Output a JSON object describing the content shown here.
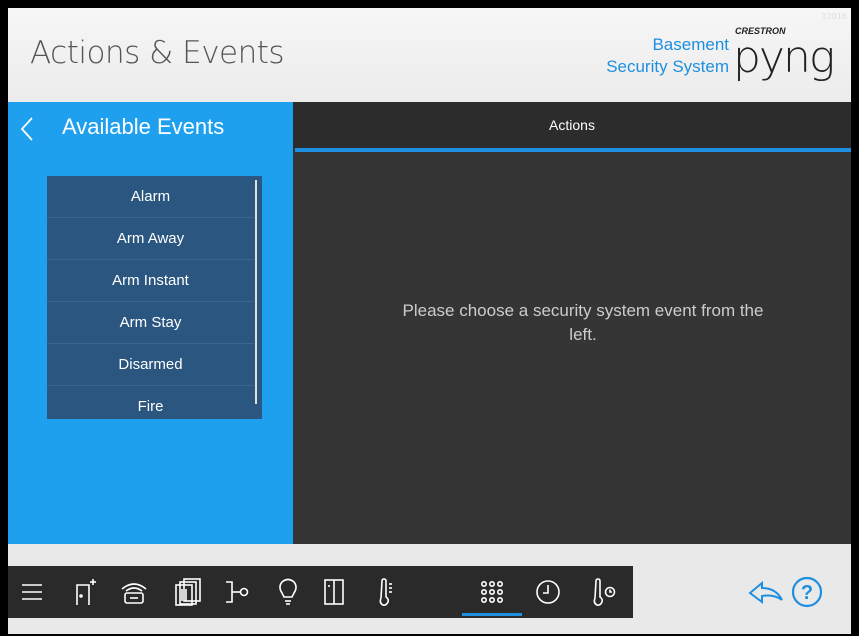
{
  "header": {
    "title": "Actions & Events",
    "room_line1": "Basement",
    "room_line2": "Security System",
    "logo_small": "CRESTRON",
    "logo_big": "pyng",
    "corner_id": "12016"
  },
  "left_panel": {
    "back_icon": "<",
    "title": "Available Events",
    "events": [
      "Alarm",
      "Arm Away",
      "Arm Instant",
      "Arm Stay",
      "Disarmed",
      "Fire"
    ]
  },
  "right_panel": {
    "tab_label": "Actions",
    "message": "Please choose a security system event from the left."
  },
  "footer": {
    "nav_icons": [
      "menu-icon",
      "door-icon",
      "garage-icon",
      "shades-icon",
      "scene-icon",
      "light-bulb-icon",
      "window-icon",
      "thermometer-icon",
      "keypad-icon",
      "clock-icon",
      "thermostat-icon"
    ],
    "active_nav": "keypad-icon",
    "share_icon": "share-back-icon",
    "help_icon": "help-icon"
  },
  "colors": {
    "accent": "#1e8fe0",
    "left_panel": "#1ea0ee",
    "event_list": "#2a5680",
    "right_panel": "#353535",
    "navbar": "#2a2a2a"
  }
}
